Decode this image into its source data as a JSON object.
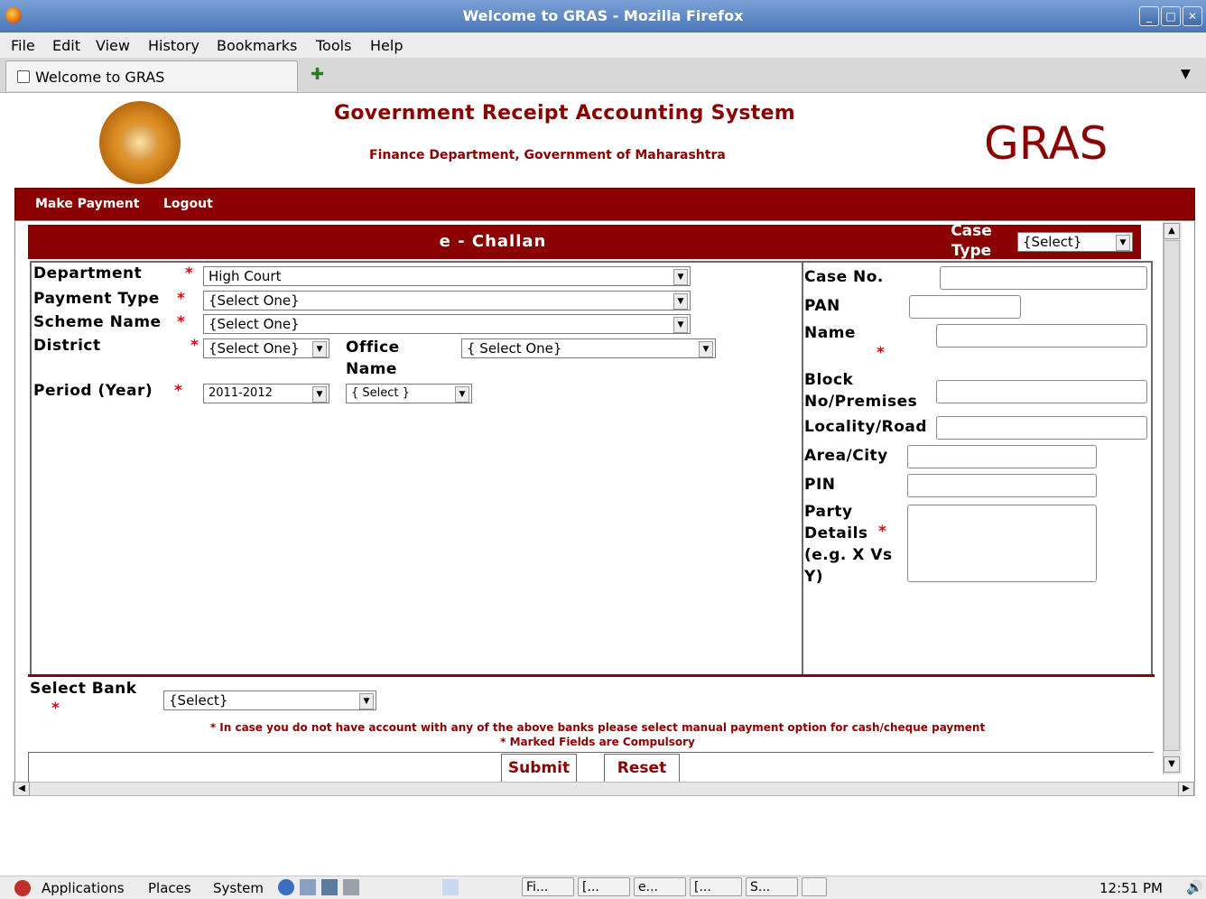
{
  "window": {
    "title": "Welcome to GRAS - Mozilla Firefox"
  },
  "menu": {
    "items": [
      "File",
      "Edit",
      "View",
      "History",
      "Bookmarks",
      "Tools",
      "Help"
    ]
  },
  "tab": {
    "label": "Welcome to GRAS"
  },
  "header": {
    "system_title": "Government Receipt Accounting System",
    "subtitle": "Finance Department, Government of Maharashtra",
    "brand": "GRAS"
  },
  "nav": {
    "make_payment": "Make Payment",
    "logout": "Logout"
  },
  "challan": {
    "title": "e - Challan",
    "case_type_label": "Case Type",
    "case_type_value": "{Select}"
  },
  "form_left": {
    "department_label": "Department",
    "department_value": "High Court",
    "payment_type_label": "Payment Type",
    "payment_type_value": "{Select One}",
    "scheme_name_label": "Scheme Name",
    "scheme_name_value": "{Select One}",
    "district_label": "District",
    "district_value": "{Select One}",
    "office_name_label": "Office Name",
    "office_name_value": "{ Select One}",
    "period_label": "Period (Year)",
    "period_value": "2011-2012",
    "period_sub_value": "{ Select }"
  },
  "form_right": {
    "case_no_label": "Case No.",
    "pan_label": "PAN",
    "name_label": "Name",
    "block_label": "Block No/Premises",
    "locality_label": "Locality/Road",
    "area_label": "Area/City",
    "pin_label": "PIN",
    "party_label": "Party Details",
    "party_hint": "(e.g. X Vs Y)"
  },
  "bank": {
    "label": "Select Bank",
    "value": "{Select}",
    "note": "* In case you do not have account with any of the above banks please select manual payment option for cash/cheque payment",
    "compulsory_note": "* Marked Fields are Compulsory"
  },
  "buttons": {
    "submit": "Submit",
    "reset": "Reset"
  },
  "taskbar": {
    "applications": "Applications",
    "places": "Places",
    "system": "System",
    "tasks": [
      "Fi...",
      "[...",
      "e...",
      "[...",
      "S..."
    ],
    "clock": "12:51 PM"
  },
  "colors": {
    "brand": "#8b0000",
    "required": "#d01010"
  }
}
